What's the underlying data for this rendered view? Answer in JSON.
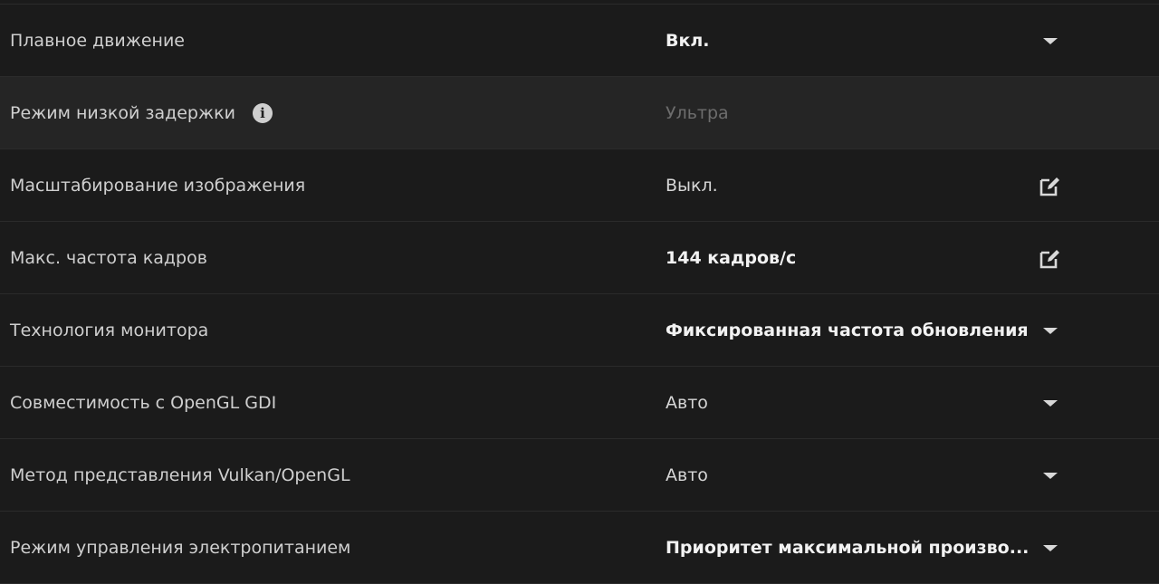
{
  "settings": [
    {
      "label": "Плавное движение",
      "value": "Вкл.",
      "control": "dropdown",
      "bold": true
    },
    {
      "label": "Режим низкой задержки",
      "value": "Ультра",
      "control": "none",
      "disabled": true,
      "info": "i"
    },
    {
      "label": "Масштабирование изображения",
      "value": "Выкл.",
      "control": "edit"
    },
    {
      "label": "Макс. частота кадров",
      "value": "144 кадров/с",
      "control": "edit",
      "bold": true
    },
    {
      "label": "Технология монитора",
      "value": "Фиксированная частота обновления",
      "control": "dropdown",
      "bold": true
    },
    {
      "label": "Совместимость с OpenGL GDI",
      "value": "Авто",
      "control": "dropdown"
    },
    {
      "label": "Метод представления Vulkan/OpenGL",
      "value": "Авто",
      "control": "dropdown"
    },
    {
      "label": "Режим управления электропитанием",
      "value": "Приоритет максимальной произво...",
      "control": "dropdown",
      "bold": true
    }
  ],
  "icons": {
    "dropdown": "chevron-down-icon",
    "edit": "edit-icon",
    "info": "info-icon"
  },
  "colors": {
    "background": "#1b1b1b",
    "row_disabled": "#252525",
    "divider": "#2b2b2b",
    "text": "#cfcfcf",
    "text_bold": "#f2f2f2",
    "text_muted": "#6d6d6d"
  }
}
